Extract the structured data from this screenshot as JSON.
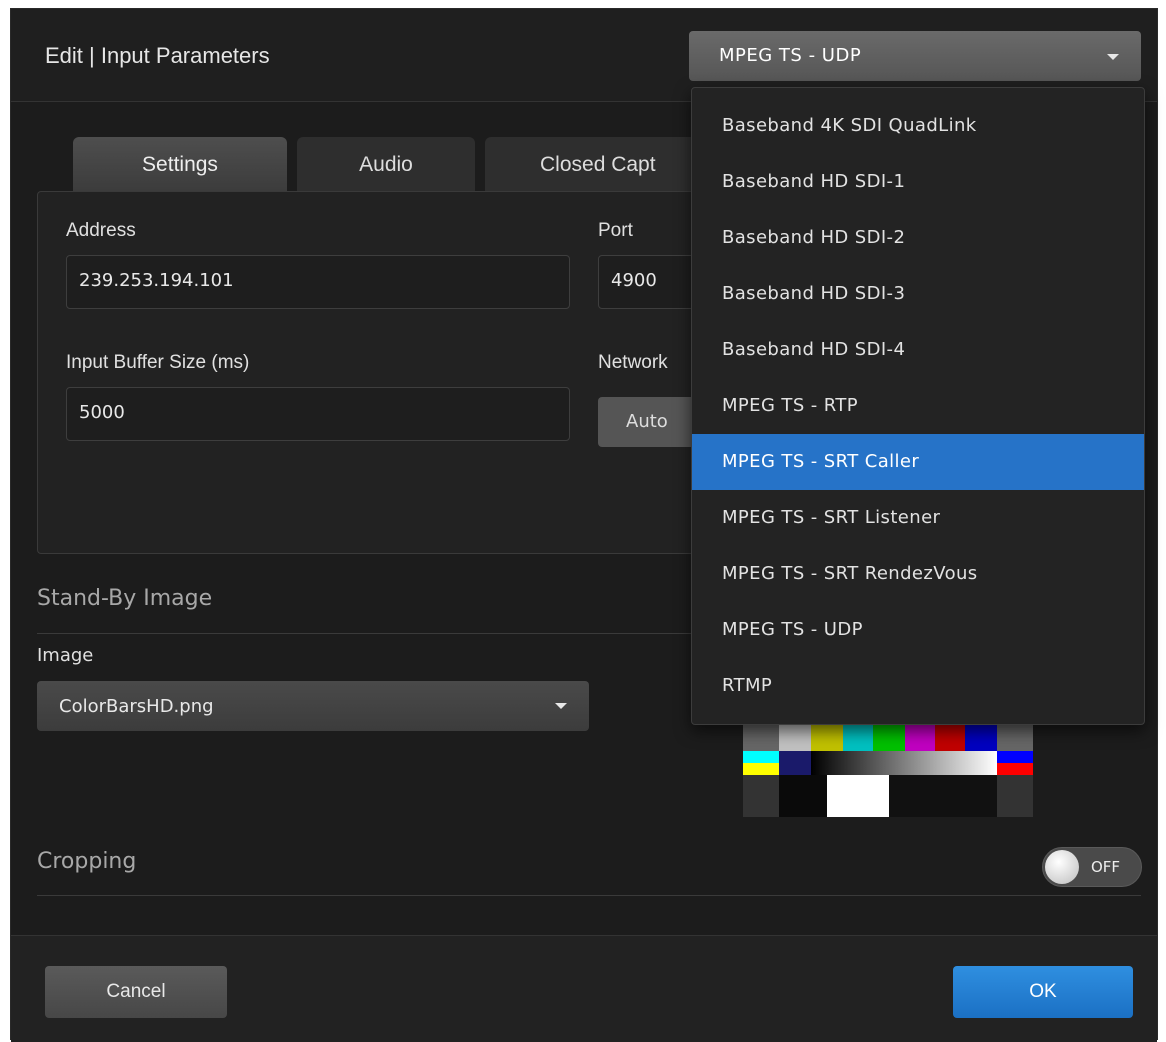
{
  "header": {
    "title": "Edit | Input Parameters",
    "source_select": {
      "value": "MPEG TS - UDP"
    }
  },
  "tabs": [
    {
      "label": "Settings",
      "active": true
    },
    {
      "label": "Audio"
    },
    {
      "label": "Closed Capt"
    }
  ],
  "settings": {
    "address_label": "Address",
    "address_value": "239.253.194.101",
    "port_label": "Port",
    "port_value": "4900",
    "buffer_label": "Input Buffer Size (ms)",
    "buffer_value": "5000",
    "network_label": "Network",
    "network_value": "Auto"
  },
  "standby": {
    "section_title": "Stand-By Image",
    "image_label": "Image",
    "image_value": "ColorBarsHD.png"
  },
  "cropping": {
    "section_title": "Cropping",
    "toggle_label": "OFF",
    "enabled": false
  },
  "footer": {
    "cancel_label": "Cancel",
    "ok_label": "OK"
  },
  "dropdown": {
    "items": [
      "Baseband 4K SDI QuadLink",
      "Baseband HD SDI-1",
      "Baseband HD SDI-2",
      "Baseband HD SDI-3",
      "Baseband HD SDI-4",
      "MPEG TS - RTP",
      "MPEG TS - SRT Caller",
      "MPEG TS - SRT Listener",
      "MPEG TS - SRT RendezVous",
      "MPEG TS - UDP",
      "RTMP"
    ],
    "highlighted_index": 6
  },
  "colors": {
    "accent": "#2673c8",
    "ok_button": "#1e7fd6",
    "background": "#1c1c1c"
  }
}
